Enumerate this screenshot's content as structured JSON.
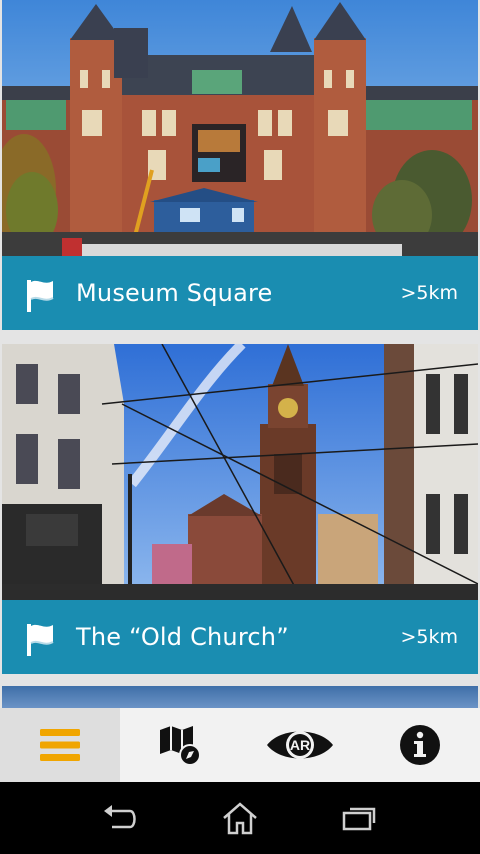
{
  "cards": [
    {
      "title": "Museum Square",
      "distance": ">5km",
      "photo": "rijksmuseum-photo"
    },
    {
      "title": "The “Old Church”",
      "distance": ">5km",
      "photo": "munttoren-photo"
    }
  ],
  "tabs": [
    {
      "icon": "menu-icon",
      "active": true
    },
    {
      "icon": "map-icon",
      "active": false
    },
    {
      "icon": "ar-eye-icon",
      "label": "AR",
      "active": false
    },
    {
      "icon": "info-icon",
      "active": false
    }
  ],
  "system_nav": [
    "back-icon",
    "home-icon",
    "recents-icon"
  ],
  "colors": {
    "accent": "#1a8db1",
    "menu": "#f0a500",
    "tabbar": "#f2f2f2"
  }
}
